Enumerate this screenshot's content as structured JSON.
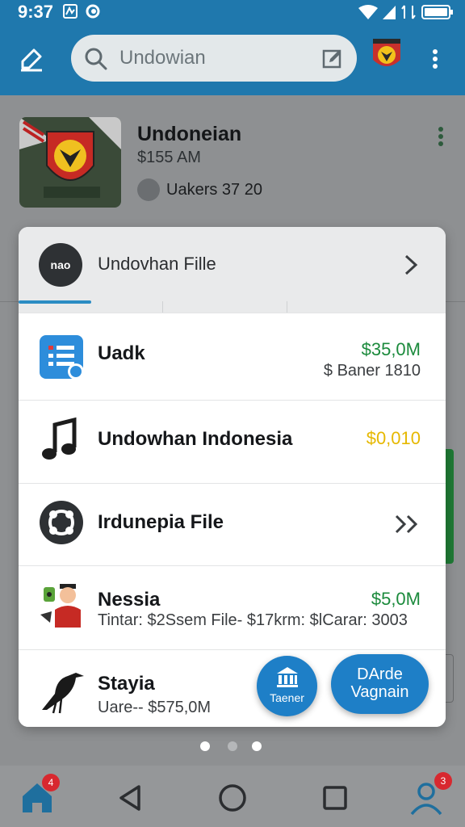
{
  "status_bar": {
    "time": "9:37"
  },
  "search": {
    "placeholder": "Undowian"
  },
  "header_card": {
    "title": "Undoneian",
    "time": "$155 AM",
    "user": "Uakers 37 20"
  },
  "sheet": {
    "head_icon_text": "nao",
    "head_title": "Undovhan Fille",
    "items": [
      {
        "title": "Uadk",
        "amount": "$35,0M",
        "amount_color": "#1b8a3c",
        "subtitle_right": "$ Baner 1810",
        "icon": "document-list-icon"
      },
      {
        "title": "Undowhan Indonesia",
        "amount": "$0,010",
        "amount_color": "#e6b800",
        "icon": "music-note-icon"
      },
      {
        "title": "Irdunepia File",
        "icon": "circle-node-icon",
        "chevron": "double-chevron-right-icon"
      },
      {
        "title": "Nessia",
        "amount": "$5,0M",
        "amount_color": "#1b8a3c",
        "subtitle": "Tintar: $2Ssem File-  $17krm: $lCarar: 3003",
        "icon": "cartoon-man-icon"
      },
      {
        "title": "Stayia",
        "subtitle": "Uare-- $575,0M",
        "icon": "crow-icon"
      }
    ],
    "fab_primary": "Taener",
    "fab_secondary_line1": "DArde",
    "fab_secondary_line2": "Vagnain"
  },
  "nav": {
    "home_badge": "4",
    "profile_badge": "3"
  },
  "colors": {
    "accent": "#1f78ad",
    "fab": "#1e7fc7",
    "positive": "#1b8a3c",
    "warning": "#e6b800"
  }
}
